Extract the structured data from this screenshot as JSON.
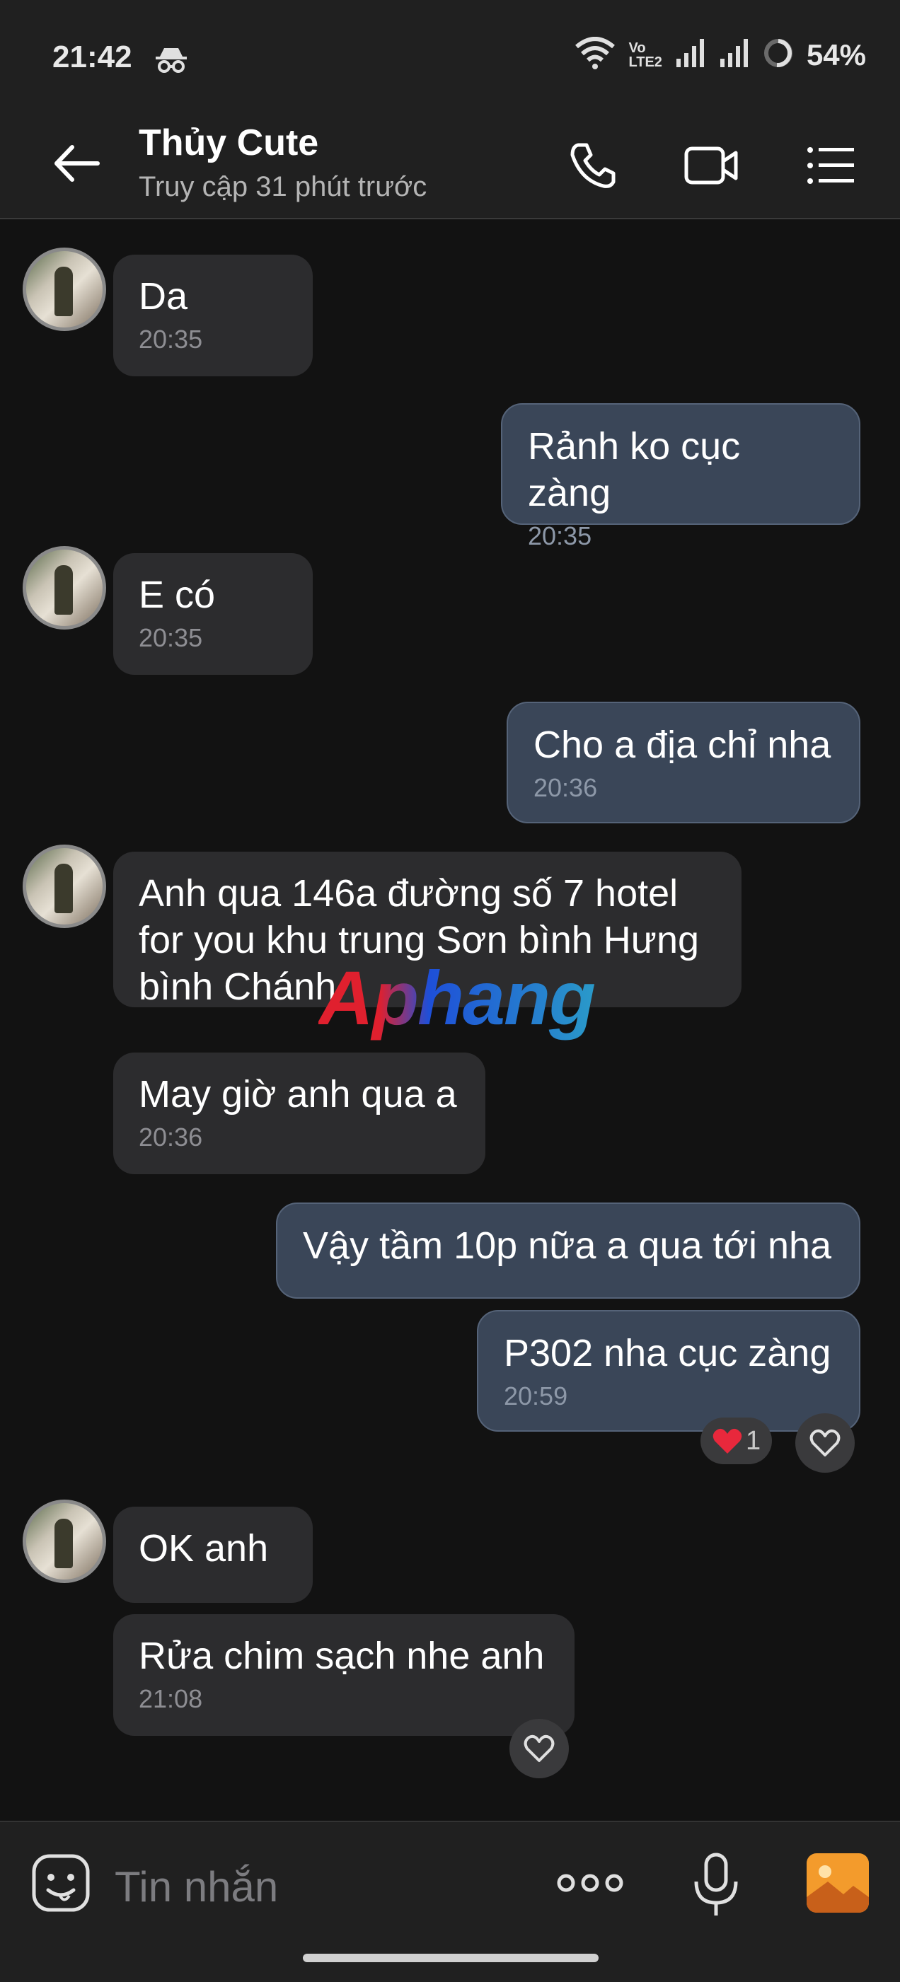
{
  "status_bar": {
    "time": "21:42",
    "battery": "54%",
    "volte_top": "Vo",
    "volte_bottom": "LTE2"
  },
  "header": {
    "contact_name": "Thủy Cute",
    "last_seen": "Truy cập 31 phút trước"
  },
  "messages": [
    {
      "side": "in",
      "text": "Da",
      "time": "20:35"
    },
    {
      "side": "out",
      "text": "Rảnh ko cục zàng",
      "time": "20:35"
    },
    {
      "side": "in",
      "text": "E có",
      "time": "20:35"
    },
    {
      "side": "out",
      "text": "Cho a địa chỉ nha",
      "time": "20:36"
    },
    {
      "side": "in",
      "text_lines": [
        "Anh qua 146a đường số 7 hotel",
        "for you khu trung Sơn bình Hưng",
        "bình Chánh"
      ]
    },
    {
      "side": "in",
      "text": "May giờ anh qua a",
      "time": "20:36"
    },
    {
      "side": "out",
      "text": "Vậy tầm 10p nữa a qua tới nha"
    },
    {
      "side": "out",
      "text": "P302 nha cục zàng",
      "time": "20:59",
      "reaction_count": "1"
    },
    {
      "side": "in",
      "text": "OK anh"
    },
    {
      "side": "in",
      "text": "Rửa chim sạch nhe anh",
      "time": "21:08"
    }
  ],
  "watermark": "Aphang",
  "input": {
    "placeholder": "Tin nhắn"
  },
  "colors": {
    "background": "#121212",
    "incoming_bubble": "#2c2c2e",
    "outgoing_bubble": "#3a4658",
    "gallery_icon": "#f39b2c"
  }
}
